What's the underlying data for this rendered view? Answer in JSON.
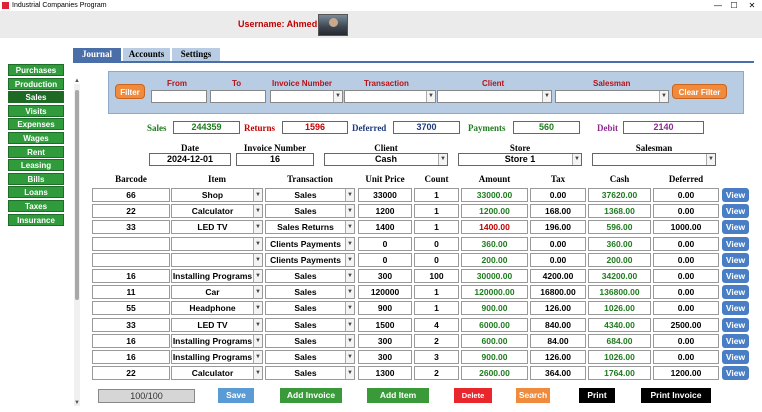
{
  "window": {
    "title": "Industrial Companies Program",
    "min_glyph": "—",
    "max_glyph": "☐",
    "close_glyph": "✕"
  },
  "header": {
    "username": "Username: Ahmed"
  },
  "sidebar": {
    "items": [
      {
        "label": "Purchases"
      },
      {
        "label": "Production"
      },
      {
        "label": "Sales"
      },
      {
        "label": "Visits"
      },
      {
        "label": "Expenses"
      },
      {
        "label": "Wages"
      },
      {
        "label": "Rent"
      },
      {
        "label": "Leasing"
      },
      {
        "label": "Bills"
      },
      {
        "label": "Loans"
      },
      {
        "label": "Taxes"
      },
      {
        "label": "Insurance"
      }
    ],
    "active": "Sales"
  },
  "tabs": [
    {
      "label": "Journal"
    },
    {
      "label": "Accounts"
    },
    {
      "label": "Settings"
    }
  ],
  "filter": {
    "filter_button": "Filter",
    "clear_button": "Clear Filter",
    "labels": {
      "from": "From",
      "to": "To",
      "invoice_number": "Invoice Number",
      "transaction": "Transaction",
      "client": "Client",
      "salesman": "Salesman"
    }
  },
  "summary": {
    "sales_label": "Sales",
    "sales_value": "244359",
    "returns_label": "Returns",
    "returns_value": "1596",
    "deferred_label": "Deferred",
    "deferred_value": "3700",
    "payments_label": "Payments",
    "payments_value": "560",
    "debit_label": "Debit",
    "debit_value": "2140"
  },
  "invoice": {
    "date_label": "Date",
    "date_value": "2024-12-01",
    "number_label": "Invoice Number",
    "number_value": "16",
    "client_label": "Client",
    "client_value": "Cash",
    "store_label": "Store",
    "store_value": "Store 1",
    "salesman_label": "Salesman",
    "salesman_value": ""
  },
  "table": {
    "headers": {
      "barcode": "Barcode",
      "item": "Item",
      "transaction": "Transaction",
      "unit_price": "Unit Price",
      "count": "Count",
      "amount": "Amount",
      "tax": "Tax",
      "cash": "Cash",
      "deferred": "Deferred"
    },
    "view_label": "View",
    "rows": [
      {
        "barcode": "66",
        "item": "Shop",
        "transaction": "Sales",
        "unit_price": "33000",
        "count": "1",
        "amount": "33000.00",
        "tax": "0.00",
        "cash": "37620.00",
        "deferred": "0.00"
      },
      {
        "barcode": "22",
        "item": "Calculator",
        "transaction": "Sales",
        "unit_price": "1200",
        "count": "1",
        "amount": "1200.00",
        "tax": "168.00",
        "cash": "1368.00",
        "deferred": "0.00"
      },
      {
        "barcode": "33",
        "item": "LED TV",
        "transaction": "Sales Returns",
        "unit_price": "1400",
        "count": "1",
        "amount": "1400.00",
        "tax": "196.00",
        "cash": "596.00",
        "deferred": "1000.00"
      },
      {
        "barcode": "",
        "item": "",
        "transaction": "Clients Payments",
        "unit_price": "0",
        "count": "0",
        "amount": "360.00",
        "tax": "0.00",
        "cash": "360.00",
        "deferred": "0.00"
      },
      {
        "barcode": "",
        "item": "",
        "transaction": "Clients Payments",
        "unit_price": "0",
        "count": "0",
        "amount": "200.00",
        "tax": "0.00",
        "cash": "200.00",
        "deferred": "0.00"
      },
      {
        "barcode": "16",
        "item": "Installing Programs",
        "transaction": "Sales",
        "unit_price": "300",
        "count": "100",
        "amount": "30000.00",
        "tax": "4200.00",
        "cash": "34200.00",
        "deferred": "0.00"
      },
      {
        "barcode": "11",
        "item": "Car",
        "transaction": "Sales",
        "unit_price": "120000",
        "count": "1",
        "amount": "120000.00",
        "tax": "16800.00",
        "cash": "136800.00",
        "deferred": "0.00"
      },
      {
        "barcode": "55",
        "item": "Headphone",
        "transaction": "Sales",
        "unit_price": "900",
        "count": "1",
        "amount": "900.00",
        "tax": "126.00",
        "cash": "1026.00",
        "deferred": "0.00"
      },
      {
        "barcode": "33",
        "item": "LED TV",
        "transaction": "Sales",
        "unit_price": "1500",
        "count": "4",
        "amount": "6000.00",
        "tax": "840.00",
        "cash": "4340.00",
        "deferred": "2500.00"
      },
      {
        "barcode": "16",
        "item": "Installing Programs",
        "transaction": "Sales",
        "unit_price": "300",
        "count": "2",
        "amount": "600.00",
        "tax": "84.00",
        "cash": "684.00",
        "deferred": "0.00"
      },
      {
        "barcode": "16",
        "item": "Installing Programs",
        "transaction": "Sales",
        "unit_price": "300",
        "count": "3",
        "amount": "900.00",
        "tax": "126.00",
        "cash": "1026.00",
        "deferred": "0.00"
      },
      {
        "barcode": "22",
        "item": "Calculator",
        "transaction": "Sales",
        "unit_price": "1300",
        "count": "2",
        "amount": "2600.00",
        "tax": "364.00",
        "cash": "1764.00",
        "deferred": "1200.00"
      }
    ]
  },
  "footer": {
    "counter": "100/100",
    "save": "Save",
    "add_invoice": "Add Invoice",
    "add_item": "Add Item",
    "delete": "Delete",
    "search": "Search",
    "print": "Print",
    "print_invoice": "Print Invoice"
  },
  "colors": {
    "green": "#2f9b3b",
    "dark_green": "#1e6a25",
    "blue_tab": "#4a6fa8",
    "panel": "#b8cce4",
    "orange": "#f08a3c",
    "red_text": "#c00000",
    "amount_green": "#1e7b1e",
    "delete_red": "#e8262c",
    "search_orange": "#f08a3c"
  }
}
